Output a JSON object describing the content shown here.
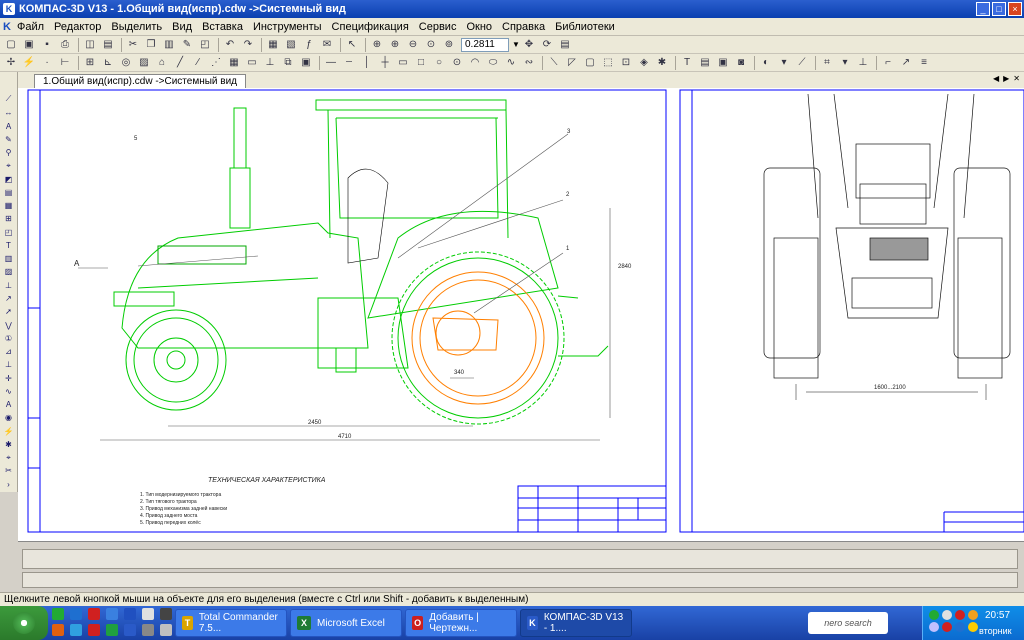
{
  "title": "КОМПАС-3D V13 - 1.Общий вид(испр).cdw ->Системный вид",
  "menu": [
    "Файл",
    "Редактор",
    "Выделить",
    "Вид",
    "Вставка",
    "Инструменты",
    "Спецификация",
    "Сервис",
    "Окно",
    "Справка",
    "Библиотеки"
  ],
  "zoom_value": "0.2811",
  "document_tab": "1.Общий вид(испр).cdw ->Системный вид",
  "drawing": {
    "view_label": "A",
    "callouts": [
      "1",
      "2",
      "3",
      "5"
    ],
    "dim_bottom_total": "4710",
    "dim_wheelbase": "2450",
    "dim_height": "2840",
    "dim_small": "340",
    "dim_front_track": "1600...2100",
    "tech_heading": "ТЕХНИЧЕСКАЯ ХАРАКТЕРИСТИКА",
    "spec_lines": [
      "1. Тип модернизируемого трактора",
      "2. Тип тягового трактора",
      "3. Привод механизма задней навески",
      "4. Привод заднего моста",
      "5. Привод передних колёс"
    ]
  },
  "status_hint": "Щелкните левой кнопкой мыши на объекте для его выделения (вместе с Ctrl или Shift - добавить к выделенным)",
  "taskbar": {
    "tasks": [
      {
        "label": "Total Commander 7.5...",
        "color": "#d9a400",
        "glyph": "T"
      },
      {
        "label": "Microsoft Excel",
        "color": "#1e7b34",
        "glyph": "X"
      },
      {
        "label": "Добавить | Чертежн...",
        "color": "#cc1f1f",
        "glyph": "O"
      },
      {
        "label": "КОМПАС-3D V13 - 1....",
        "color": "#2a5ac8",
        "glyph": "K"
      }
    ],
    "nero": "nero search",
    "clock": "20:57",
    "day": "вторник"
  }
}
